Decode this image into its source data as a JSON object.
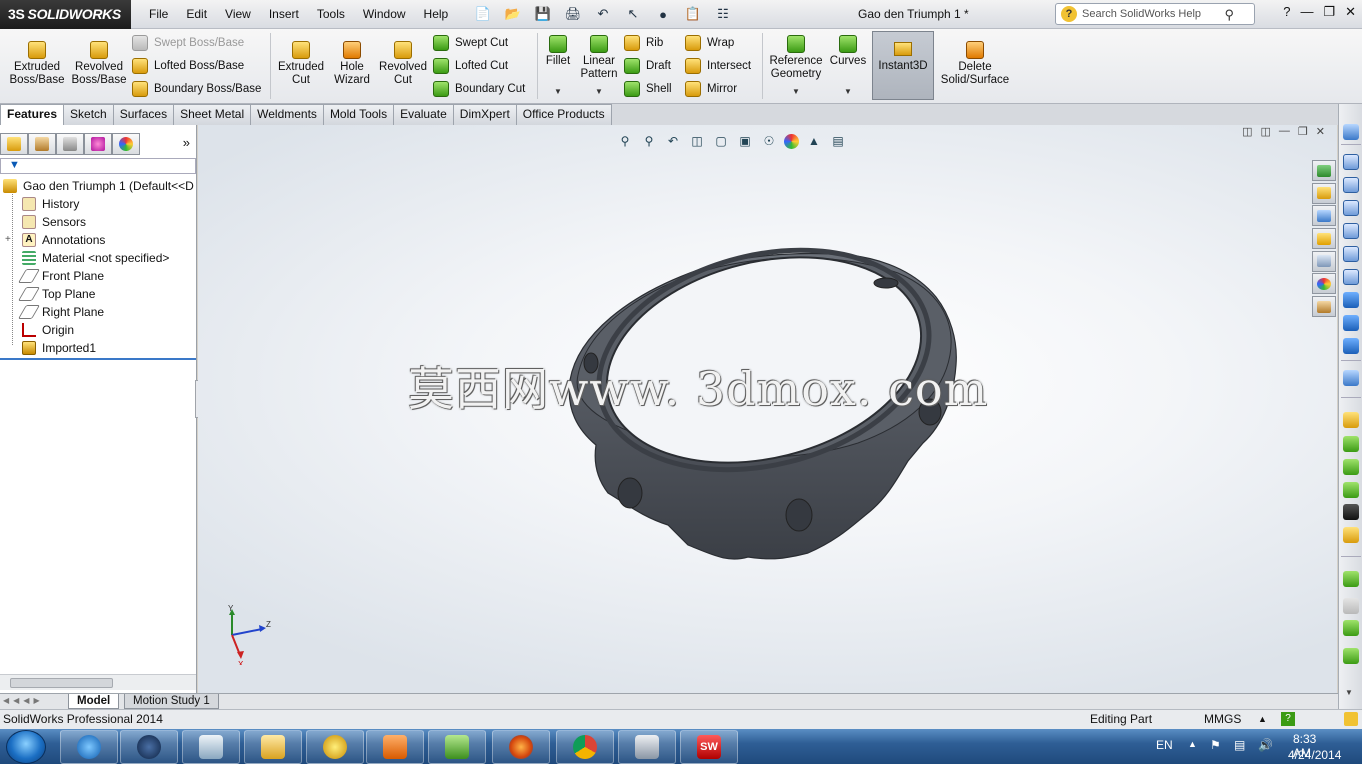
{
  "app": {
    "brand": "SOLIDWORKS",
    "document_title": "Gao den Triumph 1 *"
  },
  "menu": [
    "File",
    "Edit",
    "View",
    "Insert",
    "Tools",
    "Window",
    "Help"
  ],
  "help_search": {
    "placeholder": "Search SolidWorks Help"
  },
  "ribbon": {
    "extruded_boss": "Extruded\nBoss/Base",
    "revolved_boss": "Revolved\nBoss/Base",
    "swept_boss": "Swept Boss/Base",
    "lofted_boss": "Lofted Boss/Base",
    "boundary_boss": "Boundary Boss/Base",
    "extruded_cut": "Extruded\nCut",
    "hole_wizard": "Hole\nWizard",
    "revolved_cut": "Revolved\nCut",
    "swept_cut": "Swept Cut",
    "lofted_cut": "Lofted Cut",
    "boundary_cut": "Boundary Cut",
    "fillet": "Fillet",
    "linear_pattern": "Linear\nPattern",
    "rib": "Rib",
    "draft": "Draft",
    "shell": "Shell",
    "wrap": "Wrap",
    "intersect": "Intersect",
    "mirror": "Mirror",
    "reference_geometry": "Reference\nGeometry",
    "curves": "Curves",
    "instant3d": "Instant3D",
    "delete_solid": "Delete\nSolid/Surface"
  },
  "tabs": [
    "Features",
    "Sketch",
    "Surfaces",
    "Sheet Metal",
    "Weldments",
    "Mold Tools",
    "Evaluate",
    "DimXpert",
    "Office Products"
  ],
  "tree": {
    "root": "Gao den Triumph 1  (Default<<D",
    "items": [
      "History",
      "Sensors",
      "Annotations",
      "Material <not specified>",
      "Front Plane",
      "Top Plane",
      "Right Plane",
      "Origin",
      "Imported1"
    ]
  },
  "viewport": {
    "watermark": "莫西网www. 3dmox. com",
    "triad": {
      "x": "X",
      "y": "Y",
      "z": "Z"
    }
  },
  "model_tabs": [
    "Model",
    "Motion Study 1"
  ],
  "status": {
    "product": "SolidWorks Professional 2014",
    "mode": "Editing Part",
    "units": "MMGS"
  },
  "taskbar": {
    "lang": "EN",
    "time": "8:33 AM",
    "date": "4/24/2014"
  },
  "colors": {
    "part": "#4a4e55",
    "accent": "#3a78c8",
    "taskbar": "#2f5f96"
  }
}
